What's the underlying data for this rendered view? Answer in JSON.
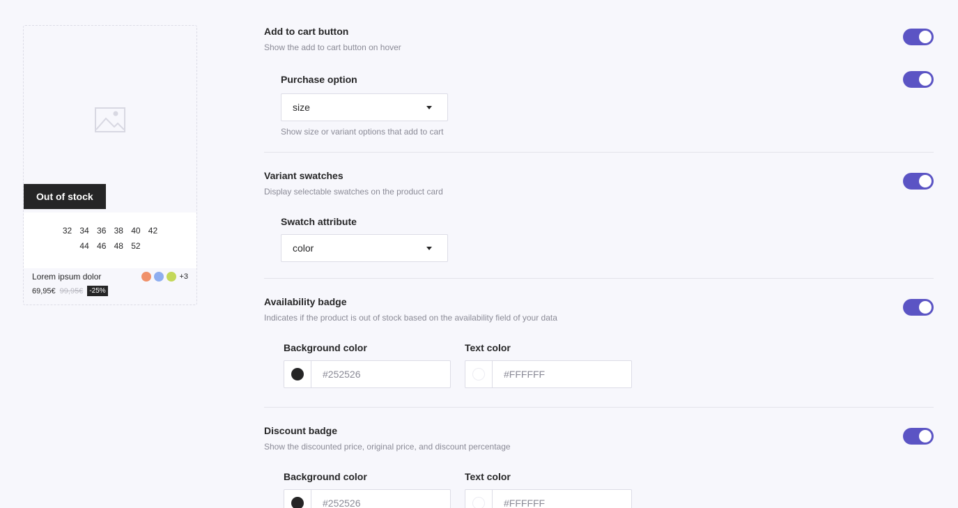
{
  "preview": {
    "out_of_stock_label": "Out of stock",
    "sizes_row1": [
      "32",
      "34",
      "36",
      "38",
      "40",
      "42"
    ],
    "sizes_row2": [
      "44",
      "46",
      "48",
      "52"
    ],
    "product_name": "Lorem ipsum dolor",
    "swatch_colors": [
      "#f0916a",
      "#8eaef0",
      "#c4d85a"
    ],
    "swatch_more": "+3",
    "price": "69,95€",
    "old_price": "99,95€",
    "discount": "-25%"
  },
  "settings": {
    "add_to_cart": {
      "title": "Add to cart button",
      "desc": "Show the add to cart button on hover",
      "enabled": true,
      "purchase_option": {
        "title": "Purchase option",
        "value": "size",
        "enabled": true,
        "hint": "Show size or variant options that add to cart"
      }
    },
    "variant_swatches": {
      "title": "Variant swatches",
      "desc": "Display selectable swatches on the product card",
      "enabled": true,
      "swatch_attribute": {
        "title": "Swatch attribute",
        "value": "color"
      }
    },
    "availability_badge": {
      "title": "Availability badge",
      "desc": "Indicates if the product is out of stock based on the availability field of your data",
      "enabled": true,
      "bg_label": "Background color",
      "bg_value": "#252526",
      "text_label": "Text color",
      "text_value": "#FFFFFF"
    },
    "discount_badge": {
      "title": "Discount badge",
      "desc": "Show the discounted price, original price, and discount percentage",
      "enabled": true,
      "bg_label": "Background color",
      "bg_value": "#252526",
      "text_label": "Text color",
      "text_value": "#FFFFFF"
    }
  },
  "colors": {
    "accent": "#5b54c4",
    "dark": "#252526"
  }
}
